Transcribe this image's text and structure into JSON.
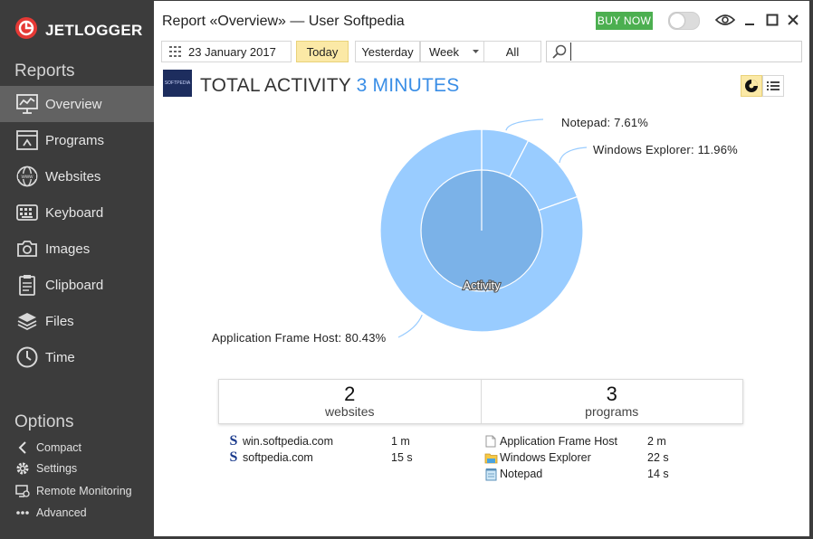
{
  "sidebar": {
    "logo_text": "JETLOGGER",
    "reports_title": "Reports",
    "nav": [
      {
        "label": "Overview",
        "icon": "chart-icon"
      },
      {
        "label": "Programs",
        "icon": "programs-icon"
      },
      {
        "label": "Websites",
        "icon": "globe-icon"
      },
      {
        "label": "Keyboard",
        "icon": "keyboard-icon"
      },
      {
        "label": "Images",
        "icon": "camera-icon"
      },
      {
        "label": "Clipboard",
        "icon": "clipboard-icon"
      },
      {
        "label": "Files",
        "icon": "files-icon"
      },
      {
        "label": "Time",
        "icon": "clock-icon"
      }
    ],
    "options_title": "Options",
    "options": [
      {
        "label": "Compact",
        "icon": "chevron-left-icon"
      },
      {
        "label": "Settings",
        "icon": "gear-icon"
      },
      {
        "label": "Remote Monitoring",
        "icon": "remote-icon"
      },
      {
        "label": "Advanced",
        "icon": "more-icon"
      }
    ]
  },
  "header": {
    "title": "Report «Overview» — User Softpedia",
    "buy_now": "BUY NOW"
  },
  "toolbar": {
    "date": "23 January 2017",
    "today": "Today",
    "yesterday": "Yesterday",
    "week": "Week",
    "all": "All",
    "search_value": ""
  },
  "activity": {
    "heading": "TOTAL ACTIVITY",
    "duration": "3 MINUTES"
  },
  "chart_data": {
    "type": "pie",
    "center_label": "Activity",
    "slices": [
      {
        "name": "Application Frame Host",
        "value": 80.43,
        "label": "Application Frame Host: 80.43%",
        "color": "#99ccff"
      },
      {
        "name": "Notepad",
        "value": 7.61,
        "label": "Notepad: 7.61%",
        "color": "#99ccff"
      },
      {
        "name": "Windows Explorer",
        "value": 11.96,
        "label": "Windows Explorer: 11.96%",
        "color": "#99ccff"
      }
    ],
    "inner_color": "#7bb2e8"
  },
  "summary": {
    "websites_count": "2",
    "websites_label": "websites",
    "programs_count": "3",
    "programs_label": "programs"
  },
  "websites": [
    {
      "name": "win.softpedia.com",
      "time": "1 m"
    },
    {
      "name": "softpedia.com",
      "time": "15 s"
    }
  ],
  "programs": [
    {
      "name": "Application Frame Host",
      "time": "2 m",
      "icon": "document-icon"
    },
    {
      "name": "Windows Explorer",
      "time": "22 s",
      "icon": "folder-icon"
    },
    {
      "name": "Notepad",
      "time": "14 s",
      "icon": "notepad-icon"
    }
  ]
}
